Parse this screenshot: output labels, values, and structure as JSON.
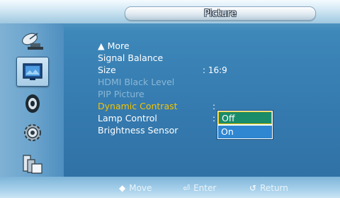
{
  "window": {
    "title": "Picture"
  },
  "sidebar": {
    "icons": [
      {
        "name": "satellite-dish-icon"
      },
      {
        "name": "picture-screen-icon",
        "selected": true
      },
      {
        "name": "sound-speaker-icon"
      },
      {
        "name": "settings-gear-icon"
      },
      {
        "name": "multi-screen-icon"
      }
    ]
  },
  "menu": {
    "items": [
      {
        "label": "▲ More"
      },
      {
        "label": "Signal Balance"
      },
      {
        "label": "Size",
        "value": ": 16:9"
      },
      {
        "label": "HDMI Black Level",
        "disabled": true
      },
      {
        "label": "PIP Picture",
        "disabled": true
      },
      {
        "label": "Dynamic Contrast",
        "active": true,
        "sep": ":"
      },
      {
        "label": "Lamp Control",
        "sep": ":"
      },
      {
        "label": "Brightness Sensor"
      }
    ],
    "dropdown": {
      "options": [
        "Off",
        "On"
      ],
      "selected": "Off"
    }
  },
  "footer": {
    "move": {
      "glyph": "◆",
      "label": "Move"
    },
    "enter": {
      "glyph": "⏎",
      "label": "Enter"
    },
    "return": {
      "glyph": "↺",
      "label": "Return"
    }
  },
  "colors": {
    "active_item": "#f5c200",
    "disabled_item": "#8bb7d6",
    "selected_option_bg": "#1a8c6a",
    "option_bg": "#2f86d1"
  }
}
